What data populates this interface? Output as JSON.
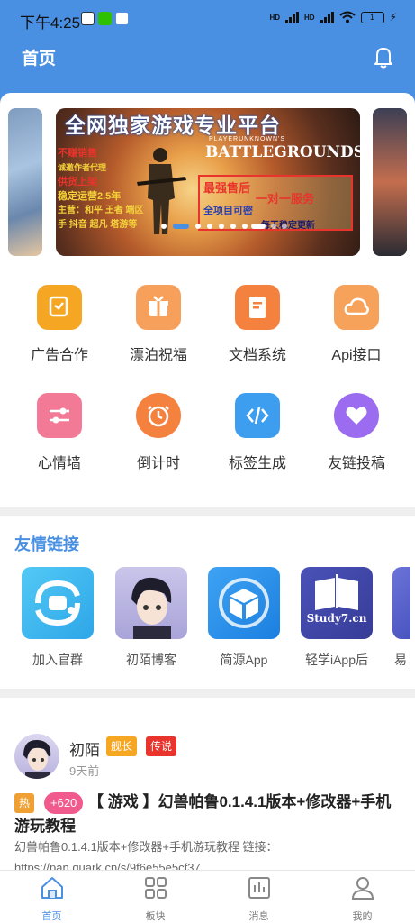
{
  "status_bar": {
    "time": "下午4:25",
    "net_labels": [
      "HD",
      "HD"
    ],
    "battery": "1"
  },
  "header": {
    "title": "首页"
  },
  "banner": {
    "title": "全网独家游戏专业平台",
    "pubg_sub": "PLAYERUNKNOWN'S",
    "pubg_title": "BATTLEGROUNDS",
    "left_lines": [
      "不赚销售",
      "诚邀作者代理",
      "供货上架",
      "稳定运营2.5年",
      "主营：和平 王者 端区",
      "手 抖音 超凡 塔游等"
    ],
    "box_line1": "最强售后",
    "box_line2": "一对一服务",
    "box_line3": "全项目可密",
    "box_line4": "每天稳定更新"
  },
  "grid": [
    {
      "label": "广告合作",
      "icon": "ad-cooperation-icon",
      "color": "#f5a623"
    },
    {
      "label": "漂泊祝福",
      "icon": "gift-icon",
      "color": "#f6a05c"
    },
    {
      "label": "文档系统",
      "icon": "document-icon",
      "color": "#f5813f"
    },
    {
      "label": "Api接口",
      "icon": "cloud-icon",
      "color": "#f7a25a"
    },
    {
      "label": "心情墙",
      "icon": "sliders-icon",
      "color": "#f27a96"
    },
    {
      "label": "倒计时",
      "icon": "clock-icon",
      "color": "#f5813f"
    },
    {
      "label": "标签生成",
      "icon": "code-icon",
      "color": "#3d9ef0"
    },
    {
      "label": "友链投稿",
      "icon": "heart-icon",
      "color": "#9b6cf0"
    }
  ],
  "links": {
    "heading": "友情链接",
    "items": [
      {
        "label": "加入官群"
      },
      {
        "label": "初陌博客"
      },
      {
        "label": "简源App"
      },
      {
        "label": "轻学iApp后"
      },
      {
        "label": "易"
      }
    ],
    "study_label": "Study7.cn"
  },
  "post": {
    "author": "初陌",
    "badge1": "舰长",
    "badge2": "传说",
    "time": "9天前",
    "hot": "热",
    "score": "+620",
    "title": "【 游戏 】幻兽帕鲁0.1.4.1版本+修改器+手机游玩教程",
    "desc": "幻兽帕鲁0.1.4.1版本+修改器+手机游玩教程 链接：https://pan.quark.cn/s/9f6e55e5cf37 ..."
  },
  "nav": [
    {
      "label": "首页"
    },
    {
      "label": "板块"
    },
    {
      "label": "消息"
    },
    {
      "label": "我的"
    }
  ],
  "colors": {
    "primary": "#4a90e2",
    "background": "#efefef"
  }
}
